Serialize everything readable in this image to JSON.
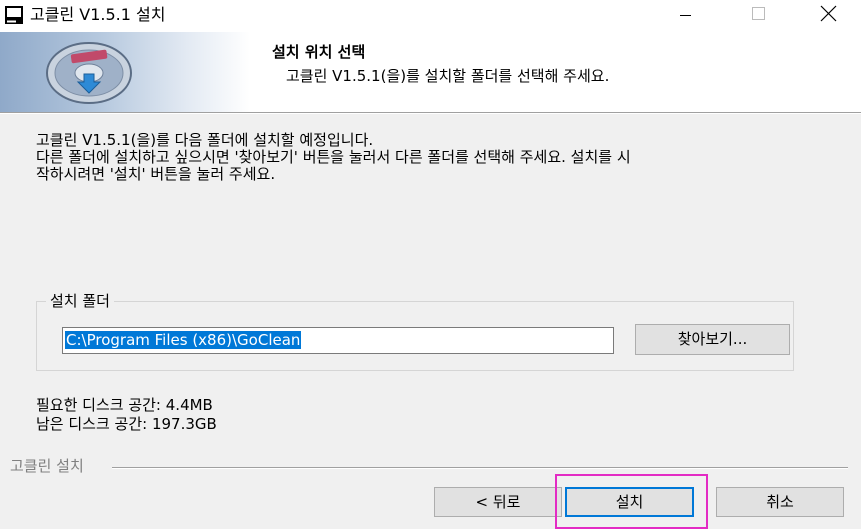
{
  "window": {
    "title": "고클린 V1.5.1 설치",
    "icons": {
      "app": "installer-computer-icon",
      "minimize": "minimize-icon",
      "maximize": "maximize-icon",
      "close": "close-icon"
    }
  },
  "header": {
    "title": "설치 위치 선택",
    "subtitle": "고클린 V1.5.1(을)를 설치할 폴더를 선택해 주세요.",
    "banner_icon": "install-disc-icon"
  },
  "intro": {
    "line1": "고클린 V1.5.1(을)를 다음 폴더에 설치할 예정입니다.",
    "line2": "다른 폴더에 설치하고 싶으시면 '찾아보기' 버튼을 눌러서 다른 폴더를 선택해 주세요. 설치를 시",
    "line3": "작하시려면 '설치' 버튼을 눌러 주세요."
  },
  "destination": {
    "group_label": "설치 폴더",
    "path_value": "C:\\Program Files (x86)\\GoClean",
    "browse_label": "찾아보기..."
  },
  "space": {
    "required": "필요한 디스크 공간: 4.4MB",
    "available": "남은 디스크 공간: 197.3GB"
  },
  "footer": {
    "label": "고클린 설치",
    "back_label": "< 뒤로",
    "install_label": "설치",
    "cancel_label": "취소"
  },
  "colors": {
    "highlight": "#e32bc4",
    "selection": "#0078d7",
    "dialog_bg": "#f0f0f0"
  }
}
